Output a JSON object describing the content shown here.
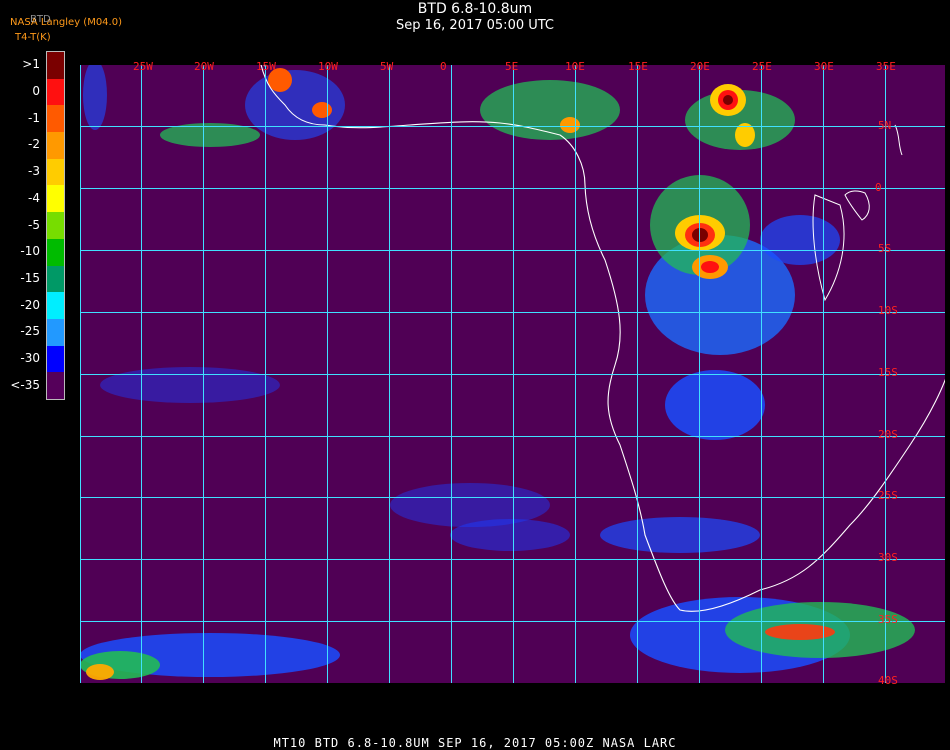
{
  "header": {
    "title": "BTD 6.8-10.8um",
    "datetime": "Sep 16, 2017 05:00 UTC",
    "source_line1": "NASA Langley (M04.0)",
    "source_line2": "BTD",
    "source_line3": "T4-T(K)"
  },
  "legend": {
    "labels": [
      ">1",
      "0",
      "-1",
      "-2",
      "-3",
      "-4",
      "-5",
      "-10",
      "-15",
      "-20",
      "-25",
      "-30",
      "<-35"
    ],
    "colors": [
      "#7a0000",
      "#ff1010",
      "#ff5a00",
      "#ff9900",
      "#ffcc00",
      "#ffff00",
      "#77dd00",
      "#00bb00",
      "#009966",
      "#00eeff",
      "#2299ff",
      "#0000ff",
      "#55005a"
    ]
  },
  "map": {
    "background_color": "#500055",
    "grid_color": "#40e0ff",
    "coast_color": "#ffffff",
    "lon_labels": [
      "25W",
      "20W",
      "15W",
      "10W",
      "5W",
      "0",
      "5E",
      "10E",
      "15E",
      "20E",
      "25E",
      "30E",
      "35E"
    ],
    "lat_labels": [
      "5N",
      "0",
      "5S",
      "10S",
      "15S",
      "20S",
      "25S",
      "30S",
      "35S",
      "40S"
    ]
  },
  "footer": {
    "text": "MT10  BTD 6.8-10.8UM  SEP 16, 2017 05:00Z  NASA LARC"
  }
}
